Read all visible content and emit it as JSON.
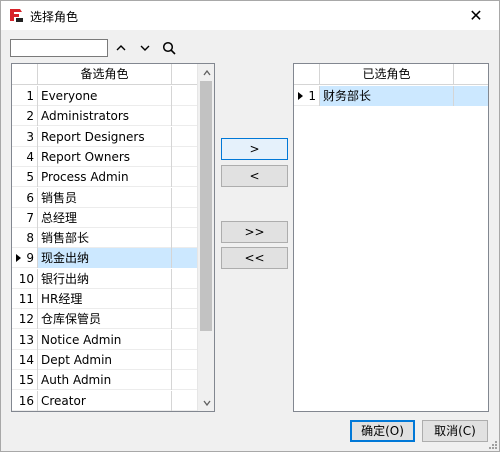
{
  "window": {
    "title": "选择角色",
    "close_glyph": "✕"
  },
  "toolbar": {
    "search_value": "",
    "up_glyph": "⌃",
    "down_glyph": "⌄",
    "search_icon": "search-icon"
  },
  "left_grid": {
    "header": "备选角色",
    "selected_index": 8,
    "rows": [
      {
        "idx": "1",
        "name": "Everyone"
      },
      {
        "idx": "2",
        "name": "Administrators"
      },
      {
        "idx": "3",
        "name": "Report Designers"
      },
      {
        "idx": "4",
        "name": "Report Owners"
      },
      {
        "idx": "5",
        "name": "Process Admin"
      },
      {
        "idx": "6",
        "name": "销售员"
      },
      {
        "idx": "7",
        "name": "总经理"
      },
      {
        "idx": "8",
        "name": "销售部长"
      },
      {
        "idx": "9",
        "name": "现金出纳"
      },
      {
        "idx": "10",
        "name": "银行出纳"
      },
      {
        "idx": "11",
        "name": "HR经理"
      },
      {
        "idx": "12",
        "name": "仓库保管员"
      },
      {
        "idx": "13",
        "name": "Notice Admin"
      },
      {
        "idx": "14",
        "name": "Dept Admin"
      },
      {
        "idx": "15",
        "name": "Auth Admin"
      },
      {
        "idx": "16",
        "name": "Creator"
      }
    ]
  },
  "right_grid": {
    "header": "已选角色",
    "rows": [
      {
        "idx": "1",
        "name": "财务部长"
      }
    ]
  },
  "move_buttons": {
    "add": ">",
    "remove": "<",
    "add_all": ">>",
    "remove_all": "<<"
  },
  "dialog_buttons": {
    "ok": "确定(O)",
    "cancel": "取消(C)"
  },
  "colors": {
    "selection": "#cce8ff",
    "accent": "#0078d7",
    "logo_red": "#d8232a"
  }
}
